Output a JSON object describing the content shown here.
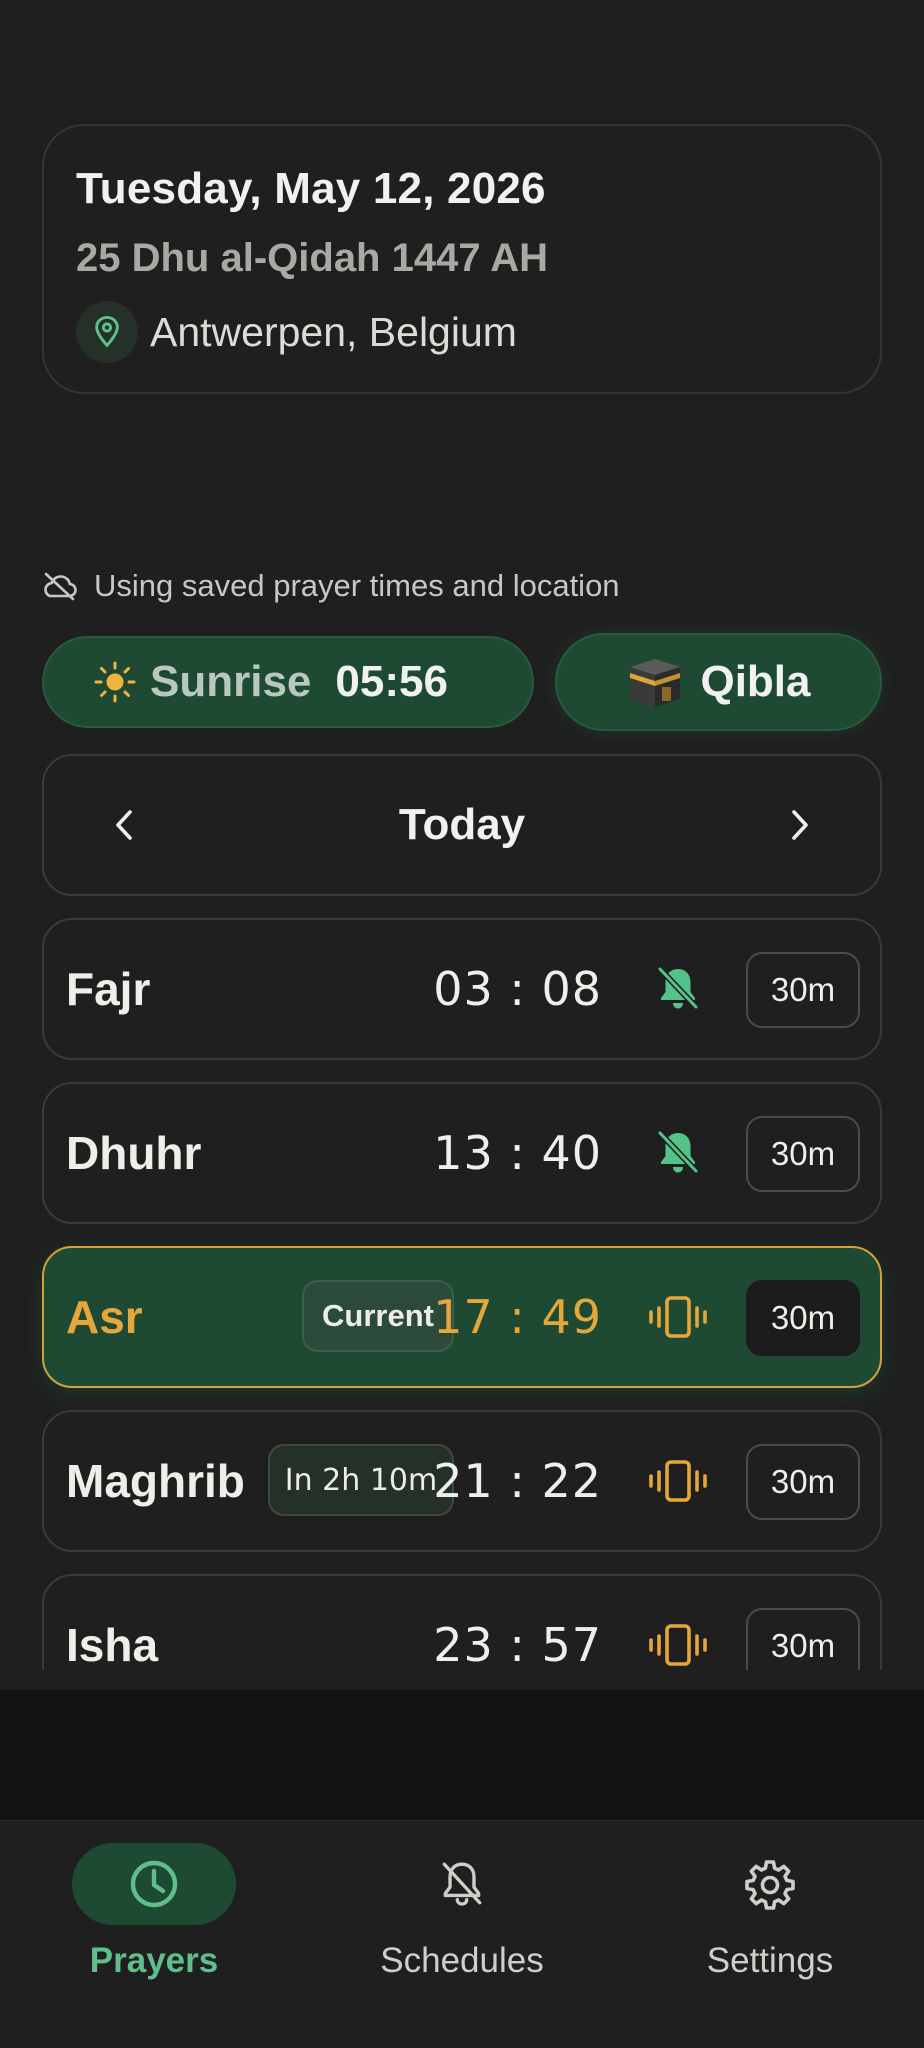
{
  "header": {
    "date": "Tuesday, May 12, 2026",
    "hijri_date": "25 Dhu al-Qidah 1447 AH",
    "location": "Antwerpen, Belgium"
  },
  "notice": {
    "text": "Using saved prayer times and location",
    "icon": "cloud-off-icon"
  },
  "sunrise": {
    "label": "Sunrise",
    "time": "05:56",
    "icon": "sun-icon"
  },
  "qibla": {
    "label": "Qibla",
    "icon": "kaaba-icon"
  },
  "day_nav": {
    "label": "Today"
  },
  "prayers": [
    {
      "name": "Fajr",
      "time": "03 : 08",
      "alert": "bell-off-icon",
      "duration": "30m"
    },
    {
      "name": "Dhuhr",
      "time": "13 : 40",
      "alert": "bell-off-icon",
      "duration": "30m"
    },
    {
      "name": "Asr",
      "time": "17 : 49",
      "alert": "vibrate-icon",
      "duration": "30m",
      "badge": "Current"
    },
    {
      "name": "Maghrib",
      "time": "21 : 22",
      "alert": "vibrate-icon",
      "duration": "30m",
      "badge": "In 2h  10m"
    },
    {
      "name": "Isha",
      "time": "23 : 57",
      "alert": "vibrate-icon",
      "duration": "30m"
    }
  ],
  "bottom_nav": {
    "items": [
      {
        "label": "Prayers",
        "icon": "clock-icon",
        "active": true
      },
      {
        "label": "Schedules",
        "icon": "bell-off-icon",
        "active": false
      },
      {
        "label": "Settings",
        "icon": "gear-icon",
        "active": false
      }
    ]
  },
  "colors": {
    "background": "#1f1f1f",
    "accent_green": "#1e4a33",
    "accent_gold": "#e5a63a",
    "active_label": "#5fbf8b"
  }
}
